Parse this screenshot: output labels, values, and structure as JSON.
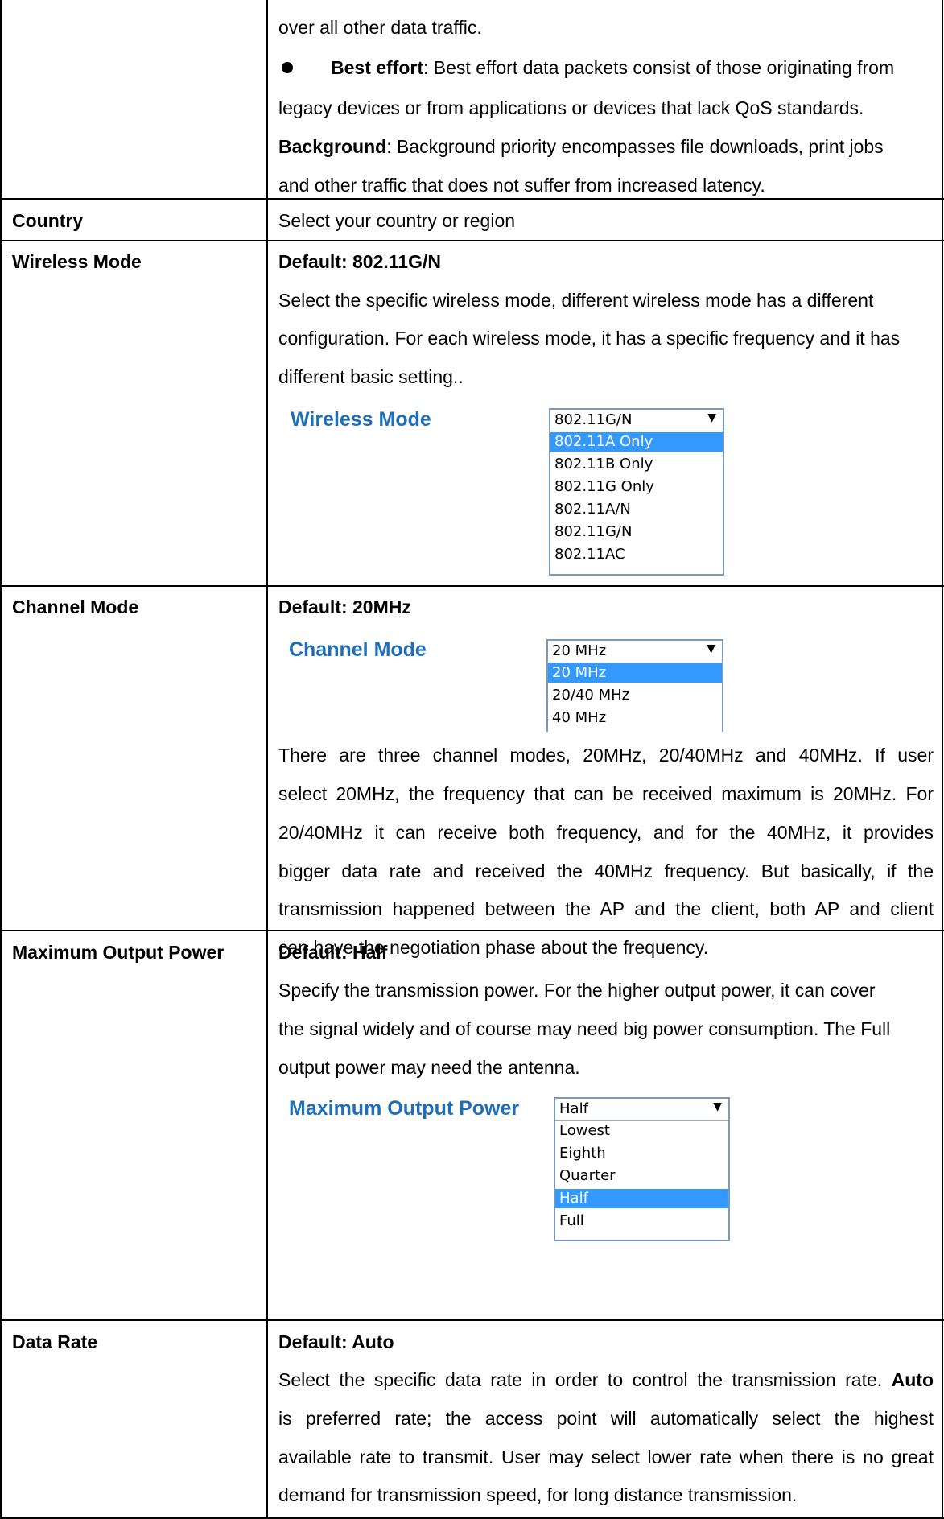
{
  "intro": {
    "line1": "over all other data traffic.",
    "best_effort_term": "Best effort",
    "best_effort_line1": ": Best effort data packets consist of those originating from",
    "best_effort_line2": "legacy devices or from applications or devices that lack QoS standards.",
    "background_term": "Background",
    "background_line1": ": Background priority encompasses file downloads, print jobs",
    "background_line2": "and other traffic that does not suffer from increased latency."
  },
  "rows": {
    "country": {
      "label": "Country",
      "desc": "Select your country or region"
    },
    "wireless_mode": {
      "label": "Wireless Mode",
      "default": "Default: 802.11G/N",
      "desc_line1": "Select the specific wireless mode, different wireless mode has a different",
      "desc_line2": "configuration. For each wireless mode, it has a specific frequency and it has",
      "desc_line3": "different basic setting..",
      "shot_label": "Wireless Mode",
      "selected": "802.11G/N",
      "options": [
        "802.11A Only",
        "802.11B Only",
        "802.11G Only",
        "802.11A/N",
        "802.11G/N",
        "802.11AC"
      ],
      "highlighted": "802.11A Only"
    },
    "channel_mode": {
      "label": "Channel Mode",
      "default": "Default: 20MHz",
      "shot_label": "Channel Mode",
      "selected": "20 MHz",
      "options": [
        "20 MHz",
        "20/40 MHz",
        "40 MHz"
      ],
      "highlighted": "20 MHz",
      "desc_line1": "There are three channel modes, 20MHz, 20/40MHz and 40MHz. If user",
      "desc_line2": "select 20MHz, the frequency that can be received maximum is 20MHz. For",
      "desc_line3": "20/40MHz it can receive both frequency, and for the 40MHz, it provides",
      "desc_line4": "bigger data rate and received the 40MHz frequency. But basically, if the",
      "desc_line5": "transmission happened between the AP and the client, both AP and client",
      "desc_line6": "can have the negotiation phase about the frequency."
    },
    "max_output_power": {
      "label": "Maximum Output Power",
      "default": "Default: Half",
      "desc_line1": "Specify the transmission power. For the higher output power, it can cover",
      "desc_line2": "the signal widely and of course may need big power consumption. The Full",
      "desc_line3": "output power may need the antenna.",
      "shot_label": "Maximum Output Power",
      "selected": "Half",
      "options": [
        "Lowest",
        "Eighth",
        "Quarter",
        "Half",
        "Full"
      ],
      "highlighted": "Half"
    },
    "data_rate": {
      "label": "Data Rate",
      "default": "Default: Auto",
      "desc_line1_pre": "Select the specific data rate in order to control the transmission rate. ",
      "desc_line1_bold": "Auto",
      "desc_line2": "is preferred rate; the access point will automatically select the highest",
      "desc_line3": "available rate to transmit. User may select lower rate when there is no great",
      "desc_line4": "demand for transmission speed, for long distance transmission."
    }
  }
}
